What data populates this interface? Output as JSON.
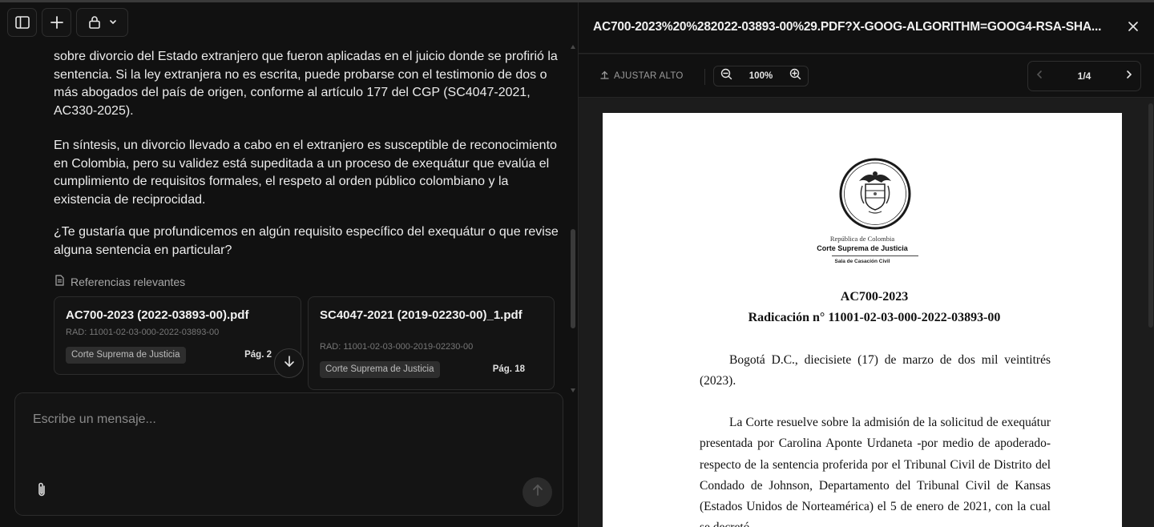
{
  "chat": {
    "paragraphs": [
      "sobre divorcio del Estado extranjero que fueron aplicadas en el juicio donde se profirió la sentencia. Si la ley extranjera no es escrita, puede probarse con el testimonio de dos o más abogados del país de origen, conforme al artículo 177 del CGP (SC4047-2021, AC330-2025).",
      "En síntesis, un divorcio llevado a cabo en el extranjero es susceptible de reconocimiento en Colombia, pero su validez está supeditada a un proceso de exequátur que evalúa el cumplimiento de requisitos formales, el respeto al orden público colombiano y la existencia de reciprocidad.",
      "¿Te gustaría que profundicemos en algún requisito específico del exequátur o que revise alguna sentencia en particular?"
    ],
    "references_title": "Referencias relevantes",
    "references": [
      {
        "name": "AC700-2023 (2022-03893-00).pdf",
        "rad": "RAD: 11001-02-03-000-2022-03893-00",
        "court": "Corte Suprema de Justicia",
        "page": "Pág. 2"
      },
      {
        "name": "SC4047-2021 (2019-02230-00)_1.pdf",
        "rad": "RAD: 11001-02-03-000-2019-02230-00",
        "court": "Corte Suprema de Justicia",
        "page": "Pág. 18"
      }
    ],
    "composer": {
      "placeholder": "Escribe un mensaje..."
    }
  },
  "pdf": {
    "title": "AC700-2023%20%282022-03893-00%29.PDF?X-GOOG-ALGORITHM=GOOG4-RSA-SHA...",
    "fit_height_label": "AJUSTAR ALTO",
    "zoom": "100%",
    "page_current": "1",
    "page_total": "4",
    "page_separator": "/",
    "document": {
      "republic": "República de Colombia",
      "court": "Corte Suprema de Justicia",
      "chamber": "Sala de Casación Civil",
      "id": "AC700-2023",
      "radicacion": "Radicación n° 11001-02-03-000-2022-03893-00",
      "paragraphs": [
        "Bogotá D.C., diecisiete (17) de marzo de dos mil veintitrés (2023).",
        "La Corte resuelve sobre la admisión de la solicitud de exequátur presentada por Carolina Aponte Urdaneta -por medio de apoderado- respecto de la sentencia proferida por el Tribunal Civil de Distrito del Condado de Johnson, Departamento del Tribunal Civil de Kansas (Estados Unidos de Norteamérica) el 5 de enero de 2021, con la cual se decretó"
      ]
    }
  },
  "icons": {
    "sidebar_toggle": "sidebar-icon",
    "new_chat": "plus-icon",
    "privacy": "lock-icon",
    "dropdown": "chevron-down-icon",
    "references": "document-icon",
    "scroll_down": "arrow-down-icon",
    "attach": "paperclip-icon",
    "send": "arrow-up-icon",
    "close": "close-icon",
    "fit": "upload-arrow-icon",
    "zoom_out": "zoom-out-icon",
    "zoom_in": "zoom-in-icon",
    "prev": "chevron-left-icon",
    "next": "chevron-right-icon"
  },
  "colors": {
    "background": "#111111",
    "pdf_background": "#1c1c1c",
    "badge": "#2e2e2e",
    "text": "#ececec"
  }
}
